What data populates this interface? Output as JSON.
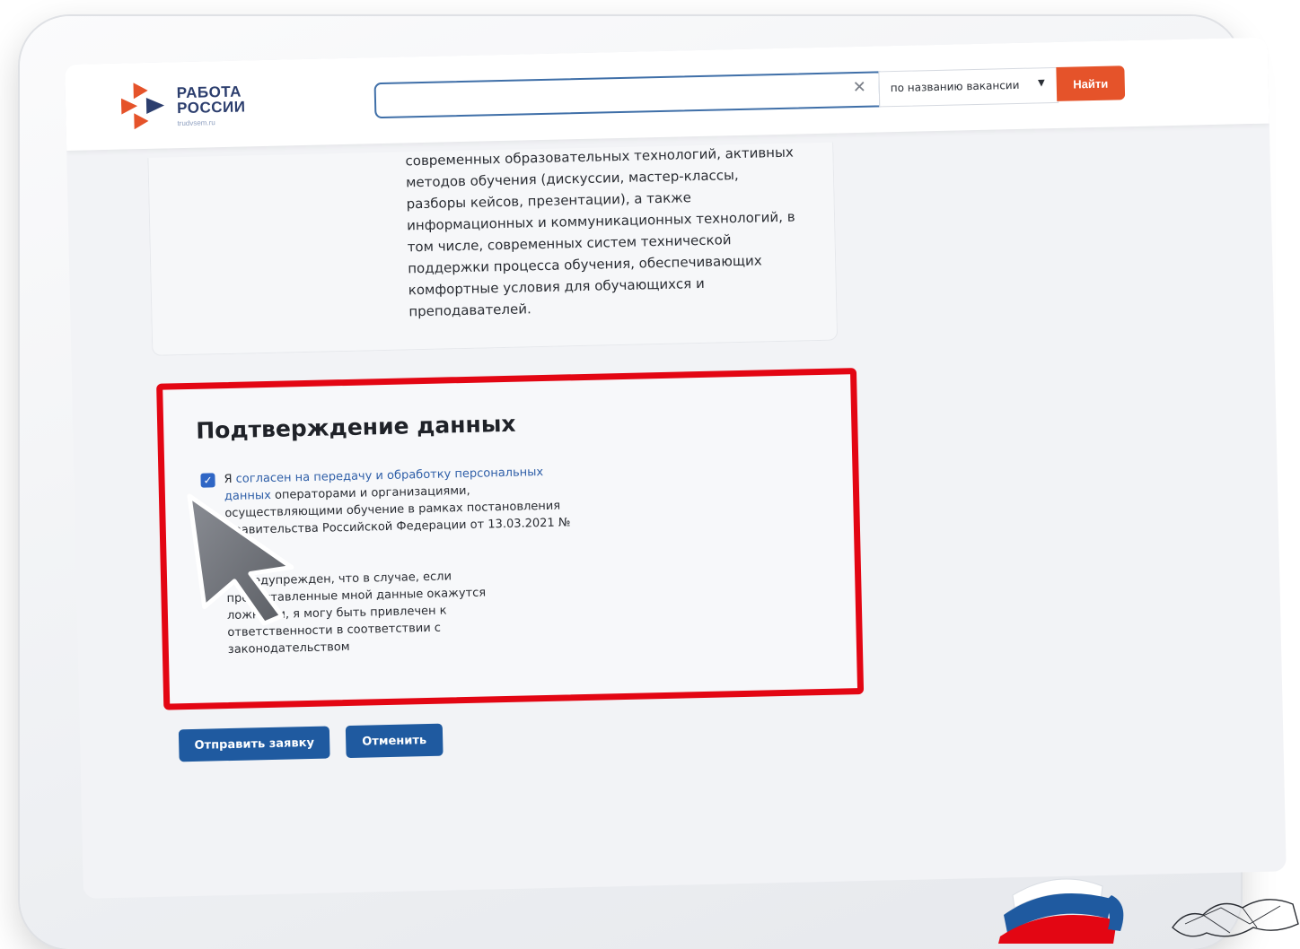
{
  "logo": {
    "line1": "РАБОТА",
    "line2": "РОССИИ",
    "site": "trudvsem.ru"
  },
  "search": {
    "value": "",
    "clear_icon": "close-icon",
    "mode_value": "по названию вакансии",
    "find_label": "Найти"
  },
  "card": {
    "text": "современных образовательных технологий, активных методов обучения (дискуссии, мастер-классы, разборы кейсов, презентации), а также информационных и коммуникационных технологий, в том числе, современных систем технической поддержки процесса обучения, обеспечивающих комфортные условия для обучающихся и преподавателей."
  },
  "confirm": {
    "title": "Подтверждение данных",
    "item1": {
      "checked": true,
      "prefix": "Я ",
      "link": "согласен на передачу и обработку персональных данных",
      "rest": " операторами и организациями, осуществляющими обучение в рамках постановления Правительства Российской Федерации от 13.03.2021 № 369"
    },
    "item2": {
      "checked": true,
      "text": "Я предупрежден, что в случае, если предоставленные мной данные окажутся ложными, я могу быть привлечен к ответственности в соответствии с законодательством"
    }
  },
  "buttons": {
    "send": "Отправить заявку",
    "cancel": "Отменить"
  },
  "colors": {
    "accent": "#1f5aa0",
    "find_button": "#e5532a",
    "highlight_frame": "#e30613",
    "checkbox": "#2f66c5"
  }
}
